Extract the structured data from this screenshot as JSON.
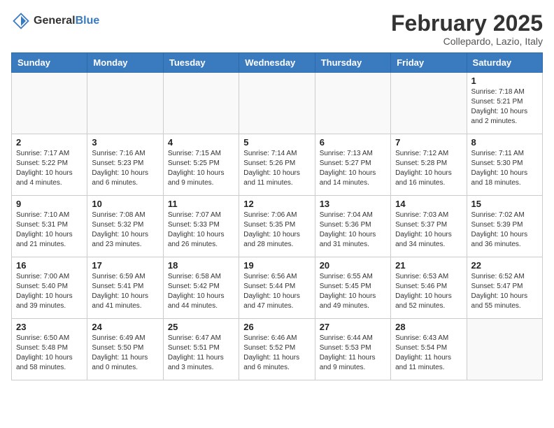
{
  "header": {
    "logo_general": "General",
    "logo_blue": "Blue",
    "month": "February 2025",
    "location": "Collepardo, Lazio, Italy"
  },
  "weekdays": [
    "Sunday",
    "Monday",
    "Tuesday",
    "Wednesday",
    "Thursday",
    "Friday",
    "Saturday"
  ],
  "weeks": [
    [
      {
        "day": "",
        "info": ""
      },
      {
        "day": "",
        "info": ""
      },
      {
        "day": "",
        "info": ""
      },
      {
        "day": "",
        "info": ""
      },
      {
        "day": "",
        "info": ""
      },
      {
        "day": "",
        "info": ""
      },
      {
        "day": "1",
        "info": "Sunrise: 7:18 AM\nSunset: 5:21 PM\nDaylight: 10 hours and 2 minutes."
      }
    ],
    [
      {
        "day": "2",
        "info": "Sunrise: 7:17 AM\nSunset: 5:22 PM\nDaylight: 10 hours and 4 minutes."
      },
      {
        "day": "3",
        "info": "Sunrise: 7:16 AM\nSunset: 5:23 PM\nDaylight: 10 hours and 6 minutes."
      },
      {
        "day": "4",
        "info": "Sunrise: 7:15 AM\nSunset: 5:25 PM\nDaylight: 10 hours and 9 minutes."
      },
      {
        "day": "5",
        "info": "Sunrise: 7:14 AM\nSunset: 5:26 PM\nDaylight: 10 hours and 11 minutes."
      },
      {
        "day": "6",
        "info": "Sunrise: 7:13 AM\nSunset: 5:27 PM\nDaylight: 10 hours and 14 minutes."
      },
      {
        "day": "7",
        "info": "Sunrise: 7:12 AM\nSunset: 5:28 PM\nDaylight: 10 hours and 16 minutes."
      },
      {
        "day": "8",
        "info": "Sunrise: 7:11 AM\nSunset: 5:30 PM\nDaylight: 10 hours and 18 minutes."
      }
    ],
    [
      {
        "day": "9",
        "info": "Sunrise: 7:10 AM\nSunset: 5:31 PM\nDaylight: 10 hours and 21 minutes."
      },
      {
        "day": "10",
        "info": "Sunrise: 7:08 AM\nSunset: 5:32 PM\nDaylight: 10 hours and 23 minutes."
      },
      {
        "day": "11",
        "info": "Sunrise: 7:07 AM\nSunset: 5:33 PM\nDaylight: 10 hours and 26 minutes."
      },
      {
        "day": "12",
        "info": "Sunrise: 7:06 AM\nSunset: 5:35 PM\nDaylight: 10 hours and 28 minutes."
      },
      {
        "day": "13",
        "info": "Sunrise: 7:04 AM\nSunset: 5:36 PM\nDaylight: 10 hours and 31 minutes."
      },
      {
        "day": "14",
        "info": "Sunrise: 7:03 AM\nSunset: 5:37 PM\nDaylight: 10 hours and 34 minutes."
      },
      {
        "day": "15",
        "info": "Sunrise: 7:02 AM\nSunset: 5:39 PM\nDaylight: 10 hours and 36 minutes."
      }
    ],
    [
      {
        "day": "16",
        "info": "Sunrise: 7:00 AM\nSunset: 5:40 PM\nDaylight: 10 hours and 39 minutes."
      },
      {
        "day": "17",
        "info": "Sunrise: 6:59 AM\nSunset: 5:41 PM\nDaylight: 10 hours and 41 minutes."
      },
      {
        "day": "18",
        "info": "Sunrise: 6:58 AM\nSunset: 5:42 PM\nDaylight: 10 hours and 44 minutes."
      },
      {
        "day": "19",
        "info": "Sunrise: 6:56 AM\nSunset: 5:44 PM\nDaylight: 10 hours and 47 minutes."
      },
      {
        "day": "20",
        "info": "Sunrise: 6:55 AM\nSunset: 5:45 PM\nDaylight: 10 hours and 49 minutes."
      },
      {
        "day": "21",
        "info": "Sunrise: 6:53 AM\nSunset: 5:46 PM\nDaylight: 10 hours and 52 minutes."
      },
      {
        "day": "22",
        "info": "Sunrise: 6:52 AM\nSunset: 5:47 PM\nDaylight: 10 hours and 55 minutes."
      }
    ],
    [
      {
        "day": "23",
        "info": "Sunrise: 6:50 AM\nSunset: 5:48 PM\nDaylight: 10 hours and 58 minutes."
      },
      {
        "day": "24",
        "info": "Sunrise: 6:49 AM\nSunset: 5:50 PM\nDaylight: 11 hours and 0 minutes."
      },
      {
        "day": "25",
        "info": "Sunrise: 6:47 AM\nSunset: 5:51 PM\nDaylight: 11 hours and 3 minutes."
      },
      {
        "day": "26",
        "info": "Sunrise: 6:46 AM\nSunset: 5:52 PM\nDaylight: 11 hours and 6 minutes."
      },
      {
        "day": "27",
        "info": "Sunrise: 6:44 AM\nSunset: 5:53 PM\nDaylight: 11 hours and 9 minutes."
      },
      {
        "day": "28",
        "info": "Sunrise: 6:43 AM\nSunset: 5:54 PM\nDaylight: 11 hours and 11 minutes."
      },
      {
        "day": "",
        "info": ""
      }
    ]
  ]
}
